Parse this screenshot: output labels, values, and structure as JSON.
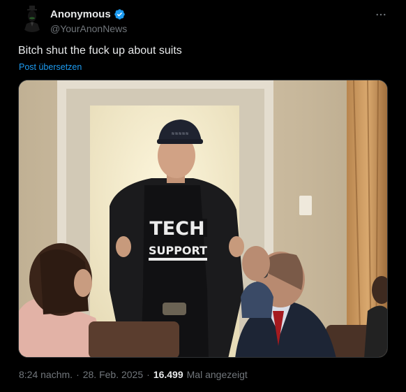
{
  "author": {
    "display_name": "Anonymous",
    "handle": "@YourAnonNews",
    "verified": true,
    "avatar_icon": "anonymous-mask-avatar"
  },
  "post": {
    "text": "Bitch shut the fuck up about suits",
    "translate_label": "Post übersetzen",
    "more_icon": "ellipsis-icon"
  },
  "media": {
    "shirt_line1": "TECH",
    "shirt_line2": "SUPPORT"
  },
  "meta": {
    "time": "8:24 nachm.",
    "sep1": "·",
    "date": "28. Feb. 2025",
    "sep2": "·",
    "views_count": "16.499",
    "views_label": "Mal angezeigt"
  },
  "colors": {
    "background": "#000000",
    "text": "#e7e9ea",
    "secondary": "#71767b",
    "link": "#1d9bf0",
    "verified_badge": "#1d9bf0"
  }
}
